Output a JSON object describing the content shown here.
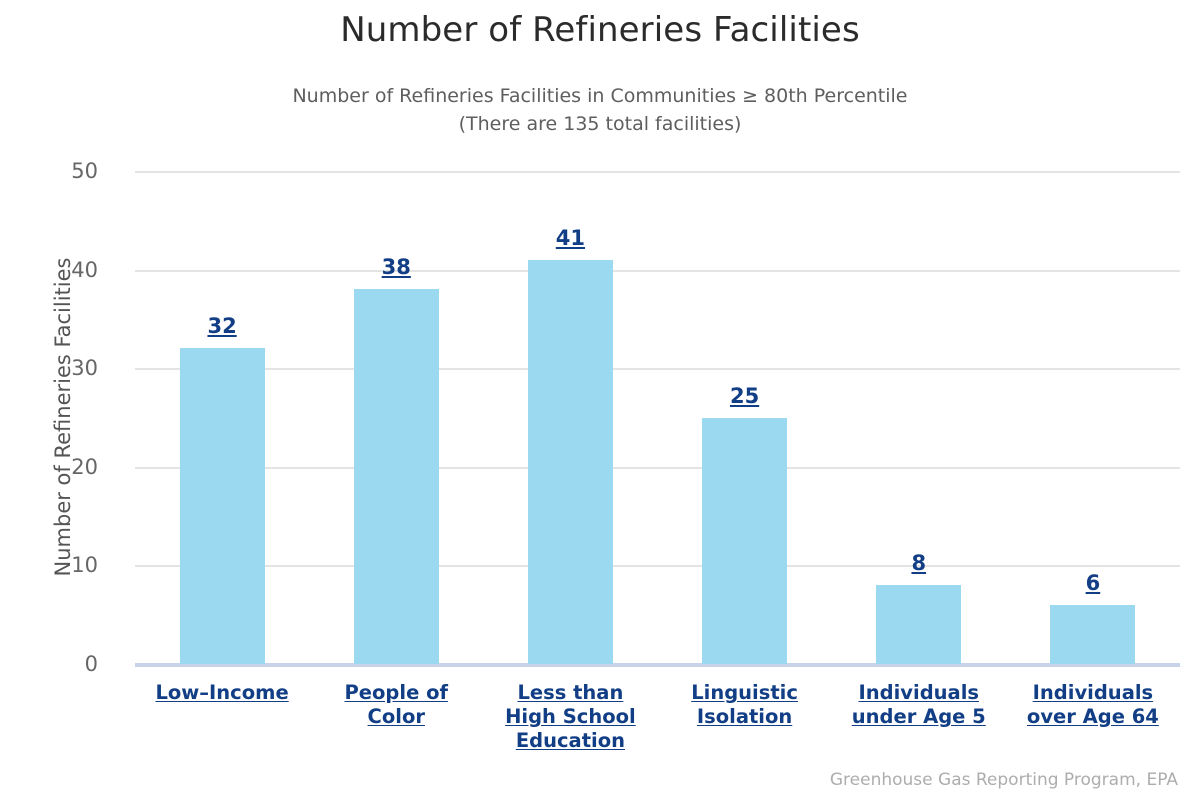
{
  "chart_data": {
    "type": "bar",
    "title": "Number of Refineries Facilities",
    "subtitle_line1": "Number of Refineries Facilities in Communities ≥ 80th Percentile",
    "subtitle_line2": "(There are 135 total facilities)",
    "xlabel": "",
    "ylabel": "Number of Refineries Facilities",
    "ylim": [
      0,
      50
    ],
    "yticks": [
      0,
      10,
      20,
      30,
      40,
      50
    ],
    "grid": true,
    "legend": "none",
    "bar_color": "#9bd9f0",
    "label_color": "#123e86",
    "categories": [
      "Low–Income",
      "People of Color",
      "Less than High School Education",
      "Linguistic Isolation",
      "Individuals under Age 5",
      "Individuals over Age 64"
    ],
    "category_lines": [
      [
        "Low–Income"
      ],
      [
        "People of",
        "Color"
      ],
      [
        "Less than",
        "High School",
        "Education"
      ],
      [
        "Linguistic",
        "Isolation"
      ],
      [
        "Individuals",
        "under Age 5"
      ],
      [
        "Individuals",
        "over Age 64"
      ]
    ],
    "values": [
      32,
      38,
      41,
      25,
      8,
      6
    ],
    "value_labels": [
      "32",
      "38",
      "41",
      "25",
      "8",
      "6"
    ],
    "total_facilities": 135,
    "source": "Greenhouse Gas Reporting Program, EPA"
  }
}
